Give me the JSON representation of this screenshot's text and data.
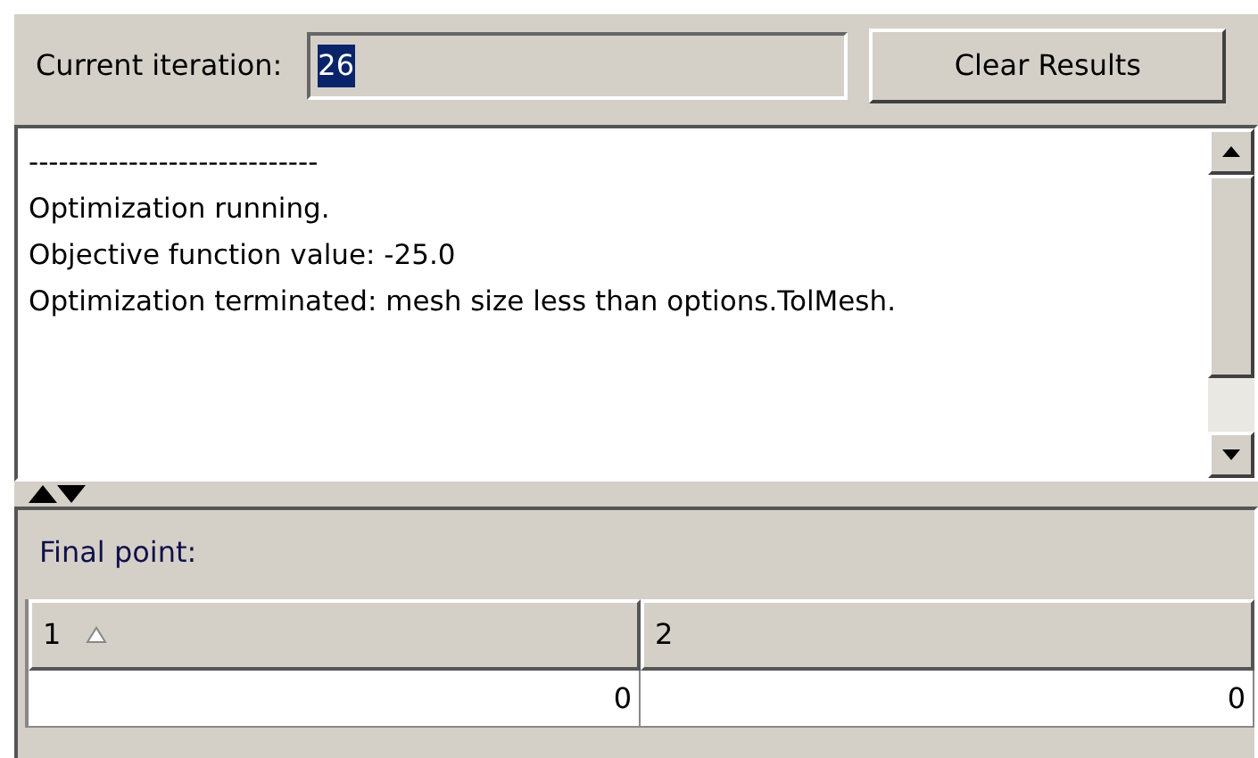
{
  "iteration": {
    "label": "Current iteration:",
    "value": "26",
    "selected": true
  },
  "clear_button": {
    "label": "Clear Results"
  },
  "output": {
    "lines": [
      "-----------------------------",
      "Optimization running.",
      "Objective function value: -25.0",
      "Optimization terminated: mesh size less than options.TolMesh."
    ]
  },
  "final_point": {
    "label": "Final point:",
    "table": {
      "columns": [
        {
          "label": "1",
          "sorted": true
        },
        {
          "label": "2",
          "sorted": false
        }
      ],
      "rows": [
        [
          "0",
          "0"
        ]
      ]
    }
  }
}
